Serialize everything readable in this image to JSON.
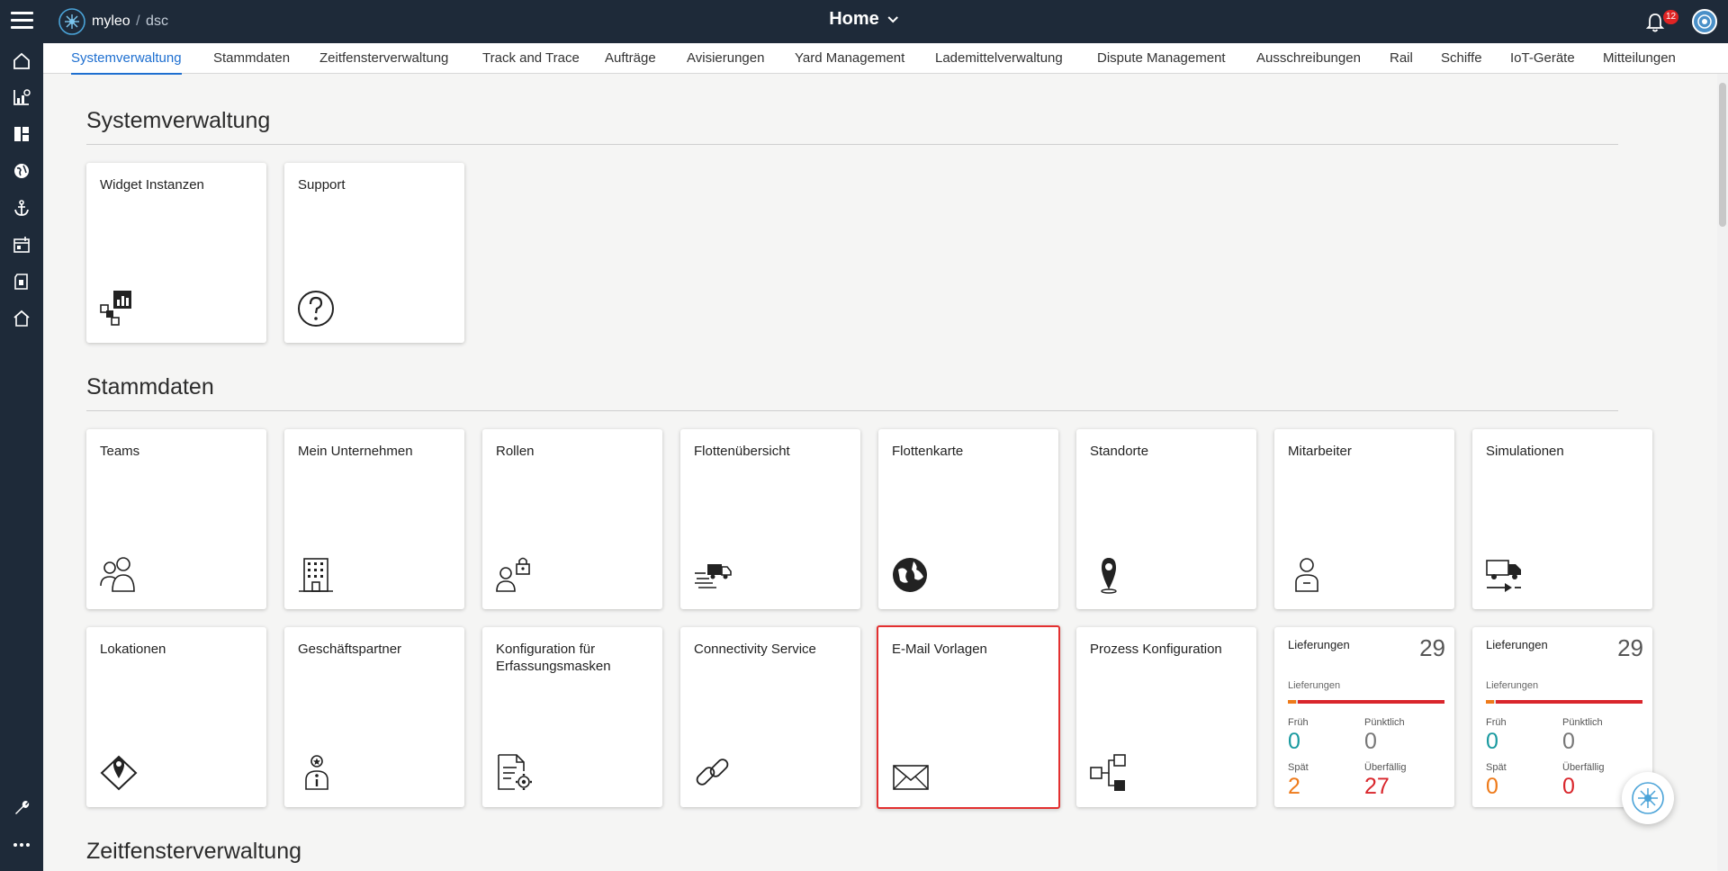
{
  "header": {
    "brand_name": "myleo",
    "brand_separator": "/",
    "brand_product": "dsc",
    "page_title": "Home",
    "notification_count": "12"
  },
  "tabs": [
    {
      "label": "Systemverwaltung",
      "active": true
    },
    {
      "label": "Stammdaten"
    },
    {
      "label": "Zeitfensterverwaltung"
    },
    {
      "label": "Track and Trace"
    },
    {
      "label": "Aufträge"
    },
    {
      "label": "Avisierungen"
    },
    {
      "label": "Yard Management"
    },
    {
      "label": "Lademittelverwaltung"
    },
    {
      "label": "Dispute Management"
    },
    {
      "label": "Ausschreibungen"
    },
    {
      "label": "Rail"
    },
    {
      "label": "Schiffe"
    },
    {
      "label": "IoT-Geräte"
    },
    {
      "label": "Mitteilungen"
    }
  ],
  "sidebar": {
    "items": [
      {
        "icon": "home-icon"
      },
      {
        "icon": "analytics-icon"
      },
      {
        "icon": "dashboard-icon"
      },
      {
        "icon": "globe-icon"
      },
      {
        "icon": "anchor-icon"
      },
      {
        "icon": "calendar-icon"
      },
      {
        "icon": "document-icon"
      },
      {
        "icon": "house-icon"
      }
    ],
    "bottom": [
      {
        "icon": "wrench-icon"
      },
      {
        "icon": "more-icon"
      }
    ]
  },
  "sections": {
    "systemverwaltung": {
      "title": "Systemverwaltung",
      "cards": [
        {
          "title": "Widget Instanzen",
          "icon": "widget-icon"
        },
        {
          "title": "Support",
          "icon": "help-icon"
        }
      ]
    },
    "stammdaten": {
      "title": "Stammdaten",
      "cards_row1": [
        {
          "title": "Teams",
          "icon": "team-icon"
        },
        {
          "title": "Mein Unternehmen",
          "icon": "building-icon"
        },
        {
          "title": "Rollen",
          "icon": "user-lock-icon"
        },
        {
          "title": "Flottenübersicht",
          "icon": "fleet-truck-icon"
        },
        {
          "title": "Flottenkarte",
          "icon": "globe-map-icon"
        },
        {
          "title": "Standorte",
          "icon": "location-pin-icon"
        },
        {
          "title": "Mitarbeiter",
          "icon": "employee-icon"
        },
        {
          "title": "Simulationen",
          "icon": "simulation-truck-icon"
        }
      ],
      "cards_row2": [
        {
          "title": "Lokationen",
          "icon": "location-diamond-icon"
        },
        {
          "title": "Geschäftspartner",
          "icon": "partner-icon"
        },
        {
          "title": "Konfiguration für Erfassungsmasken",
          "icon": "form-config-icon"
        },
        {
          "title": "Connectivity Service",
          "icon": "link-icon"
        },
        {
          "title": "E-Mail Vorlagen",
          "icon": "mail-icon"
        },
        {
          "title": "Prozess Konfiguration",
          "icon": "process-icon"
        }
      ]
    },
    "zeitfenster": {
      "title": "Zeitfensterverwaltung"
    }
  },
  "stats": [
    {
      "title": "Lieferungen",
      "total": "29",
      "subtitle": "Lieferungen",
      "early_label": "Früh",
      "early": "0",
      "ontime_label": "Pünktlich",
      "ontime": "0",
      "late_label": "Spät",
      "late": "2",
      "overdue_label": "Überfällig",
      "overdue": "27"
    },
    {
      "title": "Lieferungen",
      "total": "29",
      "subtitle": "Lieferungen",
      "early_label": "Früh",
      "early": "0",
      "ontime_label": "Pünktlich",
      "ontime": "0",
      "late_label": "Spät",
      "late": "0",
      "overdue_label": "Überfällig",
      "overdue": "0"
    }
  ],
  "colors": {
    "header_bg": "#1e2a39",
    "accent": "#1e6fd0",
    "early": "#1a9aa0",
    "late": "#ee7a1a",
    "overdue": "#d9262c",
    "selected_border": "#e33030"
  }
}
